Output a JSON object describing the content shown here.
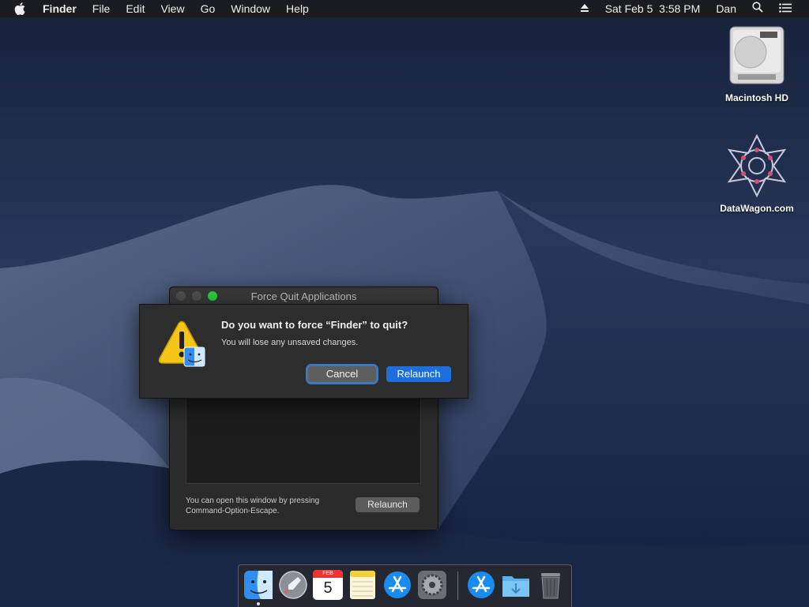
{
  "menubar": {
    "apple_icon": "apple-icon",
    "app_name": "Finder",
    "menus": [
      "File",
      "Edit",
      "View",
      "Go",
      "Window",
      "Help"
    ],
    "status": {
      "eject_icon": "eject-icon",
      "datetime": "Sat Feb 5  3:58 PM",
      "user": "Dan",
      "search_icon": "search-icon",
      "notification_icon": "list-icon"
    }
  },
  "desktop": {
    "icons": [
      {
        "label": "Macintosh HD",
        "icon": "hard-drive-icon"
      },
      {
        "label": "DataWagon.com",
        "icon": "datawagon-logo-icon"
      }
    ]
  },
  "force_quit_window": {
    "title": "Force Quit Applications",
    "hint": "You can open this window by pressing Command-Option-Escape.",
    "relaunch_label": "Relaunch"
  },
  "alert": {
    "title": "Do you want to force “Finder” to quit?",
    "message": "You will lose any unsaved changes.",
    "cancel_label": "Cancel",
    "relaunch_label": "Relaunch",
    "icon": "warning-icon"
  },
  "dock": {
    "calendar_month": "FEB",
    "calendar_day": "5",
    "items": [
      "Finder",
      "Launchpad",
      "Calendar",
      "Notes",
      "App Store",
      "System Preferences",
      "Applications",
      "Downloads",
      "Trash"
    ]
  },
  "colors": {
    "accent": "#1d6fe0",
    "menubar": "#1c1c1e",
    "window": "#2b2b2b"
  }
}
